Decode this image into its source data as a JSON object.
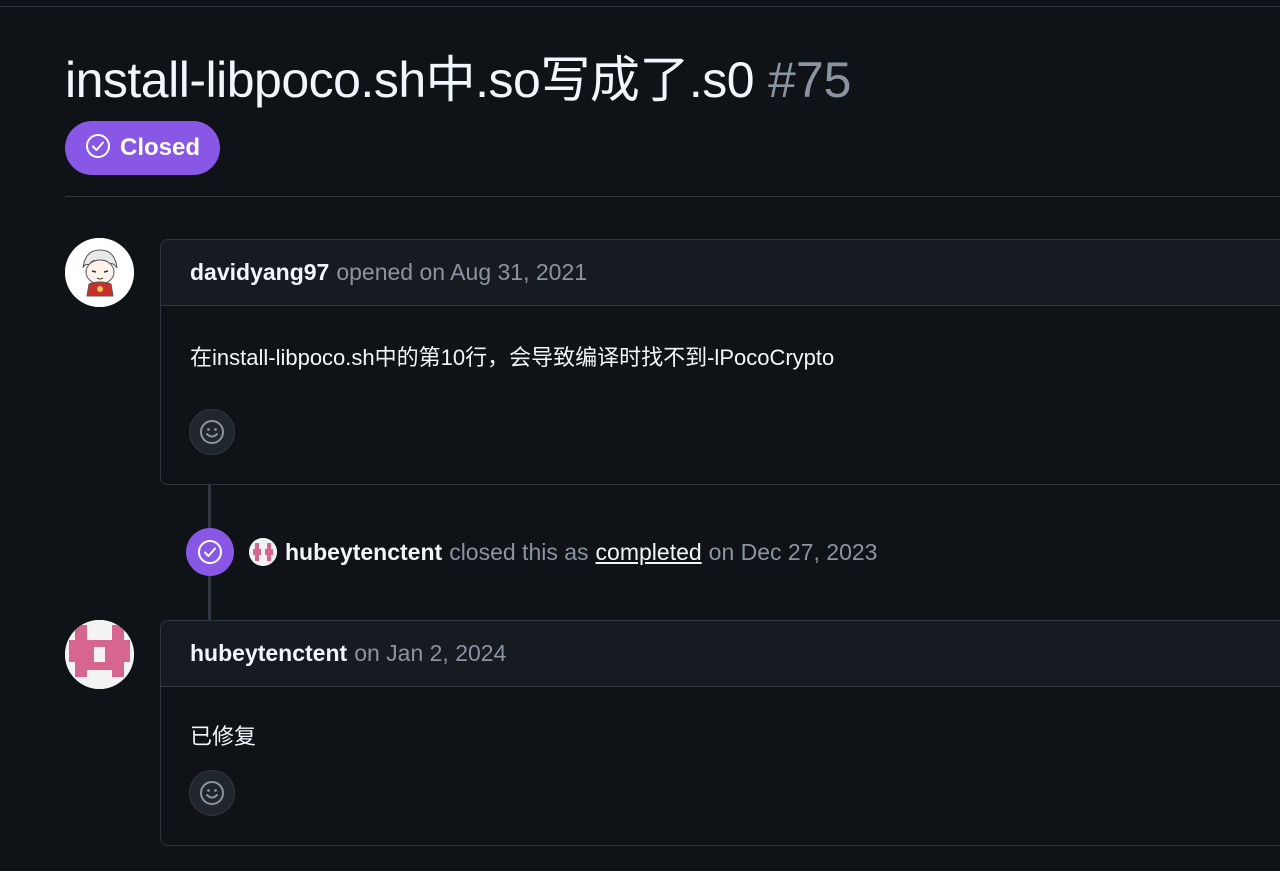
{
  "issue": {
    "title": "install-libpoco.sh中.so写成了.s0",
    "number": "#75",
    "state": "Closed",
    "state_color": "#8957e5"
  },
  "comments": [
    {
      "author": "davidyang97",
      "meta": "opened on Aug 31, 2021",
      "body": "在install-libpoco.sh中的第10行，会导致编译时找不到-lPocoCrypto",
      "avatar": "anime-character-avatar"
    },
    {
      "author": "hubeytenctent",
      "meta": "on Jan 2, 2024",
      "body": "已修复",
      "avatar": "pink-identicon-avatar"
    }
  ],
  "event": {
    "actor": "hubeytenctent",
    "text": "closed this as",
    "link": "completed",
    "date": "on Dec 27, 2023",
    "icon": "check-circle-icon"
  },
  "icons": {
    "reaction": "smiley-icon",
    "state": "check-circle-icon"
  }
}
